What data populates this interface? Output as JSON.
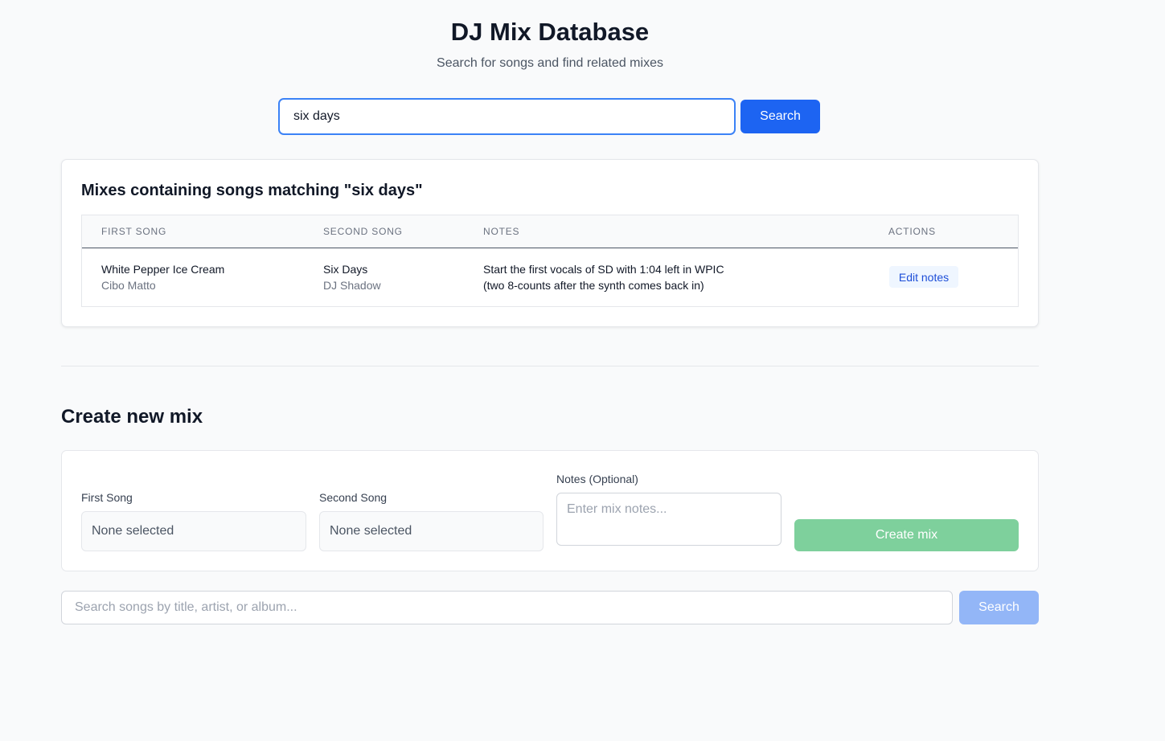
{
  "header": {
    "title": "DJ Mix Database",
    "subtitle": "Search for songs and find related mixes"
  },
  "top_search": {
    "value": "six days",
    "button_label": "Search"
  },
  "results": {
    "heading": "Mixes containing songs matching \"six days\"",
    "columns": [
      "FIRST SONG",
      "SECOND SONG",
      "NOTES",
      "ACTIONS"
    ],
    "rows": [
      {
        "first_title": "White Pepper Ice Cream",
        "first_artist": "Cibo Matto",
        "second_title": "Six Days",
        "second_artist": "DJ Shadow",
        "notes_line1": "Start the first vocals of SD with 1:04 left in WPIC",
        "notes_line2": "(two 8-counts after the synth comes back in)",
        "action_label": "Edit notes"
      }
    ]
  },
  "create": {
    "heading": "Create new mix",
    "first_label": "First Song",
    "first_value": "None selected",
    "second_label": "Second Song",
    "second_value": "None selected",
    "notes_label": "Notes (Optional)",
    "notes_placeholder": "Enter mix notes...",
    "button_label": "Create mix"
  },
  "song_search": {
    "placeholder": "Search songs by title, artist, or album...",
    "button_label": "Search"
  },
  "colors": {
    "primary": "#1d64f2",
    "create_disabled": "#7ed09c",
    "search_disabled": "#93b6f7"
  }
}
